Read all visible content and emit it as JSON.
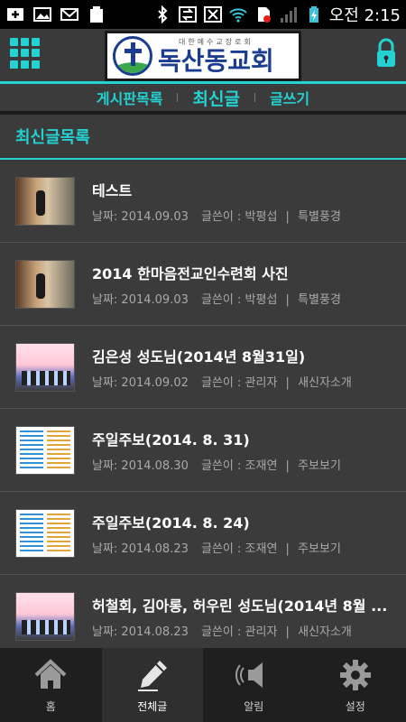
{
  "status_bar": {
    "time": "오전 2:15",
    "battery_small_label": "100"
  },
  "header": {
    "logo_subtitle": "대한예수교장로회",
    "logo_title": "독산동교회"
  },
  "tabs": [
    {
      "label": "게시판목록"
    },
    {
      "label": "최신글"
    },
    {
      "label": "글쓰기"
    }
  ],
  "section": {
    "title": "최신글목록"
  },
  "posts": [
    {
      "title": "테스트",
      "date": "날짜: 2014.09.03",
      "author": "글쓴이 : 박평섭",
      "category": "특별풍경",
      "thumb": "photo"
    },
    {
      "title": "2014 한마음전교인수련회 사진",
      "date": "날짜: 2014.09.03",
      "author": "글쓴이 : 박평섭",
      "category": "특별풍경",
      "thumb": "photo"
    },
    {
      "title": "김은성 성도님(2014년 8월31일)",
      "date": "날짜: 2014.09.02",
      "author": "글쓴이 : 관리자",
      "category": "새신자소개",
      "thumb": "group"
    },
    {
      "title": "주일주보(2014. 8. 31)",
      "date": "날짜: 2014.08.30",
      "author": "글쓴이 : 조재연",
      "category": "주보보기",
      "thumb": "doc"
    },
    {
      "title": "주일주보(2014. 8. 24)",
      "date": "날짜: 2014.08.23",
      "author": "글쓴이 : 조재연",
      "category": "주보보기",
      "thumb": "doc"
    },
    {
      "title": "허철회, 김아롱, 허우린 성도님(2014년 8월 ...",
      "date": "날짜: 2014.08.23",
      "author": "글쓴이 : 관리자",
      "category": "새신자소개",
      "thumb": "group"
    }
  ],
  "bottom_nav": [
    {
      "label": "홈",
      "icon": "home-icon"
    },
    {
      "label": "전체글",
      "icon": "pencil-icon"
    },
    {
      "label": "알림",
      "icon": "speaker-icon"
    },
    {
      "label": "설정",
      "icon": "gear-icon"
    }
  ],
  "colors": {
    "accent": "#23d3d3",
    "background": "#3b3b3b",
    "nav_background": "#1f1f1f"
  }
}
